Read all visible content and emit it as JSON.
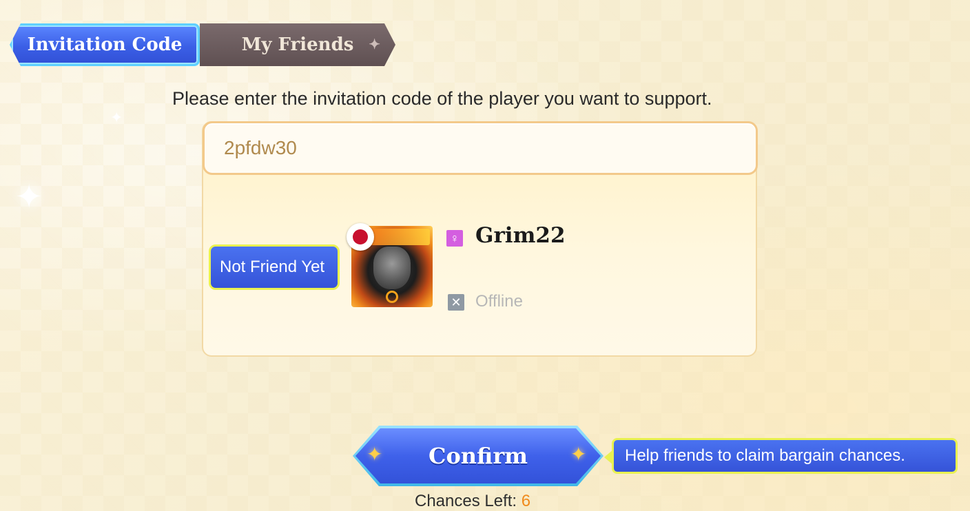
{
  "tabs": {
    "invitation_code": "Invitation Code",
    "my_friends": "My Friends",
    "active": "invitation_code"
  },
  "instruction": "Please enter the invitation code of the player you want to support.",
  "code_input": {
    "value": "2pfdw30"
  },
  "player": {
    "relationship": "Not Friend Yet",
    "name": "Grim22",
    "gender_icon": "female-icon",
    "status": "Offline",
    "country_flag": "japan-flag-icon"
  },
  "confirm_label": "Confirm",
  "tooltip": "Help friends to claim bargain chances.",
  "chances": {
    "label": "Chances Left:",
    "value": "6"
  },
  "colors": {
    "accent_blue": "#3b5fe6",
    "highlight_yellow": "#e9f150",
    "chances_orange": "#f08a1c"
  }
}
